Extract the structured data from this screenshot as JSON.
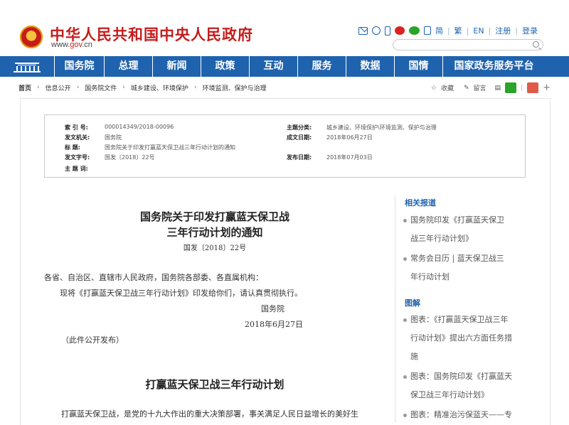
{
  "header": {
    "title": "中华人民共和国中央人民政府",
    "url_prefix": "www.",
    "url_mid": "gov",
    "url_suffix": ".cn",
    "links": [
      "简",
      "繁",
      "EN",
      "注册",
      "登录"
    ]
  },
  "nav": {
    "items": [
      "国务院",
      "总理",
      "新闻",
      "政策",
      "互动",
      "服务",
      "数据",
      "国情",
      "国家政务服务平台"
    ]
  },
  "breadcrumb": {
    "items": [
      "首页",
      "信息公开",
      "国务院文件",
      "城乡建设、环境保护",
      "环境监测、保护与治理"
    ],
    "tools": [
      "收藏",
      "留言"
    ]
  },
  "meta": {
    "index_label": "索 引 号:",
    "index_value": "000014349/2018-00096",
    "subject_label": "主题分类:",
    "subject_value": "城乡建设、环境保护\\环境监测、保护与治理",
    "issuer_label": "发文机关:",
    "issuer_value": "国务院",
    "date_label": "成文日期:",
    "date_value": "2018年06月27日",
    "title_label": "标 题:",
    "title_value": "国务院关于印发打赢蓝天保卫战三年行动计划的通知",
    "docno_label": "发文字号:",
    "docno_value": "国发〔2018〕22号",
    "pubdate_label": "发布日期:",
    "pubdate_value": "2018年07月03日",
    "keywords_label": "主 题 词:",
    "keywords_value": ""
  },
  "article": {
    "title_line1": "国务院关于印发打赢蓝天保卫战",
    "title_line2": "三年行动计划的通知",
    "doc_no": "国发〔2018〕22号",
    "addressee": "各省、自治区、直辖市人民政府，国务院各部委、各直属机构：",
    "body": "现将《打赢蓝天保卫战三年行动计划》印发给你们，请认真贯彻执行。",
    "sign": "国务院",
    "sign_date": "2018年6月27日",
    "note": "（此件公开发布）",
    "plan_title": "打赢蓝天保卫战三年行动计划",
    "plan_first_line": "打赢蓝天保卫战，是党的十九大作出的重大决策部署，事关满足人民日益增长的美好生"
  },
  "sidebar": {
    "related_heading": "相关报道",
    "related": [
      {
        "line1": "国务院印发《打赢蓝天保卫",
        "line2": "战三年行动计划》"
      },
      {
        "line1": "常务会日历 | 蓝天保卫战三",
        "line2": "年行动计划"
      }
    ],
    "graphic_heading": "图解",
    "graphics": [
      {
        "line1": "图表：《打赢蓝天保卫战三年",
        "line2": "行动计划》提出六方面任务措",
        "line3": "施"
      },
      {
        "line1": "图表：国务院印发《打赢蓝天",
        "line2": "保卫战三年行动计划》"
      },
      {
        "line1": "图表：精准治污保蓝天——专"
      }
    ]
  },
  "colors": {
    "brand_red": "#c51c1c",
    "nav_blue": "#1f62ad",
    "wechat_green": "#2aa52a",
    "weibo_red": "#e05a4a"
  }
}
